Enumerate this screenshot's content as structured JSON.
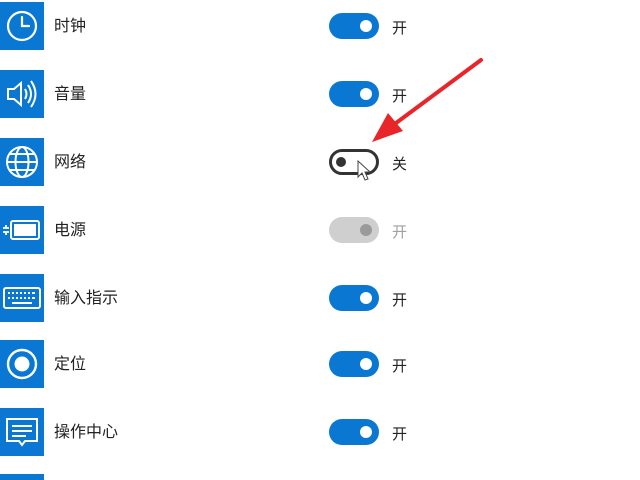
{
  "settings": [
    {
      "label": "时钟",
      "icon": "clock-icon",
      "state": "on",
      "state_label": "开"
    },
    {
      "label": "音量",
      "icon": "volume-icon",
      "state": "on",
      "state_label": "开"
    },
    {
      "label": "网络",
      "icon": "network-globe-icon",
      "state": "off",
      "state_label": "关"
    },
    {
      "label": "电源",
      "icon": "battery-power-icon",
      "state": "disabled",
      "state_label": "开"
    },
    {
      "label": "输入指示",
      "icon": "keyboard-icon",
      "state": "on",
      "state_label": "开"
    },
    {
      "label": "定位",
      "icon": "location-icon",
      "state": "on",
      "state_label": "开"
    },
    {
      "label": "操作中心",
      "icon": "action-center-icon",
      "state": "on",
      "state_label": "开"
    }
  ],
  "colors": {
    "accent": "#0a78d2",
    "toggle_off_border": "#333333",
    "toggle_disabled": "#cfcfcf",
    "annotation_arrow": "#e8262a"
  },
  "annotation": {
    "icon": "red-arrow-icon",
    "points_to": "网络"
  },
  "cursor": {
    "icon": "mouse-pointer-icon"
  }
}
